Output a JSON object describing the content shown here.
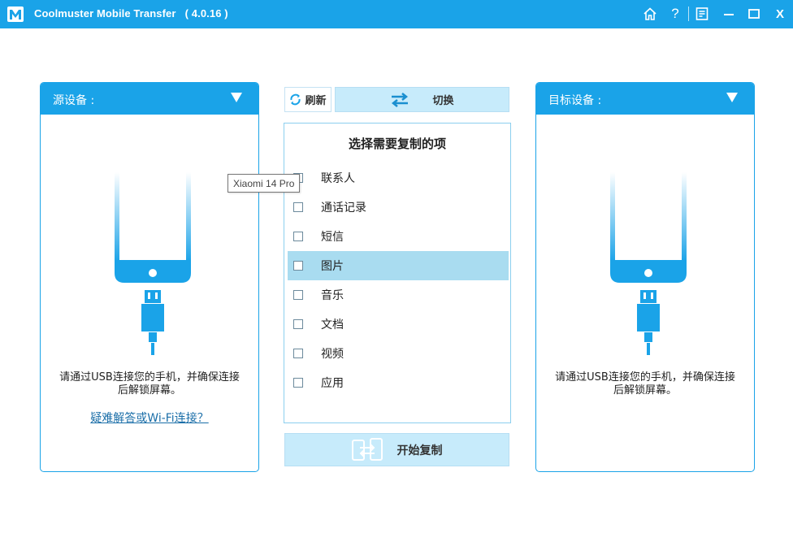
{
  "app": {
    "title": "Coolmuster Mobile Transfer   ( 4.0.16 )",
    "accent_color": "#1aa3e8",
    "title_icons": [
      "home-icon",
      "help-icon",
      "feedback-icon",
      "minimize-icon",
      "maximize-icon",
      "close-icon"
    ],
    "help_glyph": "?",
    "close_glyph": "X"
  },
  "source_panel": {
    "title": "源设备 :",
    "message": "请通过USB连接您的手机，并确保连接后解锁屏幕。",
    "link": "疑难解答或Wi-Fi连接？"
  },
  "target_panel": {
    "title": "目标设备 :",
    "message": "请通过USB连接您的手机，并确保连接后解锁屏幕。"
  },
  "middle": {
    "refresh_label": "刷新",
    "switch_label": "切换",
    "list_title": "选择需要复制的项",
    "items": [
      {
        "label": "联系人",
        "checked": false
      },
      {
        "label": "通话记录",
        "checked": false
      },
      {
        "label": "短信",
        "checked": false
      },
      {
        "label": "图片",
        "checked": false,
        "highlighted": true
      },
      {
        "label": "音乐",
        "checked": false
      },
      {
        "label": "文档",
        "checked": false
      },
      {
        "label": "视频",
        "checked": false
      },
      {
        "label": "应用",
        "checked": false
      }
    ],
    "start_label": "开始复制"
  },
  "tooltip": {
    "text": "Xiaomi 14 Pro"
  }
}
